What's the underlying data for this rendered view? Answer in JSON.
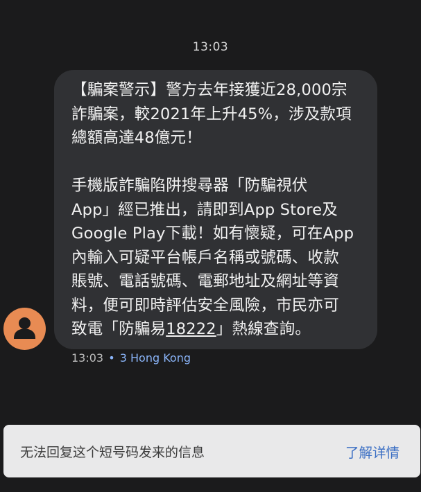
{
  "conversation": {
    "header_time": "13:03"
  },
  "message": {
    "para1": "【騙案警示】警方去年接獲近28,000宗\n詐騙案，較2021年上升45%，涉及款項\n總額高達48億元！",
    "para2_before_link": "手機版詐騙陷阱搜尋器「防騙視伏\nApp」經已推出，請即到App Store及\nGoogle Play下載！如有懷疑，可在App\n內輸入可疑平台帳戶名稱或號碼、收款\n賬號、電話號碼、電郵地址及網址等資\n料，便可即時評估安全風險，市民亦可\n致電「防騙易",
    "link_number": "18222",
    "para2_after_link": "」熱線查詢。",
    "time": "13:03",
    "separator": "•",
    "sim_label": "3 Hong Kong"
  },
  "sender": {
    "avatar_icon": "person-icon",
    "avatar_color": "#e88b53"
  },
  "footer": {
    "info_text": "无法回复这个短号码发来的信息",
    "learn_more": "了解详情"
  },
  "colors": {
    "background": "#1b1b1c",
    "bubble": "#303134",
    "accent": "#8ab4f8",
    "footer_bg": "#e9e9ea",
    "link_blue": "#3b6fc4"
  }
}
